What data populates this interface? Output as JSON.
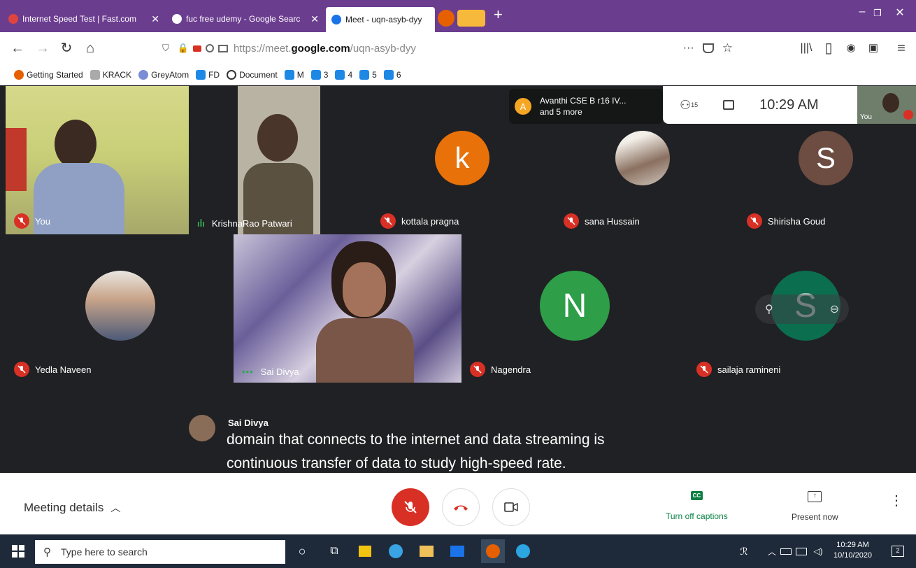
{
  "browser": {
    "tabs": [
      {
        "title": "Internet Speed Test | Fast.com",
        "color": "#e0443e"
      },
      {
        "title": "fuc free udemy - Google Searc",
        "color": "#ffffff"
      },
      {
        "title": "Meet - uqn-asyb-dyy",
        "color": "#1a73e8"
      }
    ],
    "new_tab": "+",
    "window_controls": [
      "–",
      "❐",
      "✕"
    ],
    "url_prefix": "https://meet.",
    "url_domain": "google.com",
    "url_path": "/uqn-asyb-dyy",
    "url_menu": "···",
    "bookmarks": [
      {
        "label": "Getting Started",
        "color": "#e66000"
      },
      {
        "label": "KRACK",
        "color": "#888888"
      },
      {
        "label": "GreyAtom",
        "color": "#7b8cd6"
      },
      {
        "label": "FD",
        "color": "#1e88e5"
      },
      {
        "label": "Document",
        "color": "#333333"
      },
      {
        "label": "M",
        "color": "#1e88e5"
      },
      {
        "label": "3",
        "color": "#1e88e5"
      },
      {
        "label": "4",
        "color": "#1e88e5"
      },
      {
        "label": "5",
        "color": "#1e88e5"
      },
      {
        "label": "6",
        "color": "#1e88e5"
      }
    ]
  },
  "meet": {
    "presenter_pill": {
      "initial": "A",
      "line1": "Avanthi CSE B r16 IV...",
      "line2": "and 5 more"
    },
    "participants_count": "15",
    "clock": "10:29 AM",
    "self_label": "You",
    "tiles": [
      {
        "name": "You",
        "muted": true
      },
      {
        "name": "KrishnaRao Patwari",
        "muted": false
      },
      {
        "name": "kottala pragna",
        "muted": true,
        "initial": "k",
        "avatar_color": "#e8710a"
      },
      {
        "name": "sana Hussain",
        "muted": true
      },
      {
        "name": "Shirisha Goud",
        "muted": true,
        "initial": "S",
        "avatar_color": "#6d4c41"
      },
      {
        "name": "Yedla Naveen",
        "muted": true
      },
      {
        "name": "Sai Divya",
        "muted": false
      },
      {
        "name": "Nagendra",
        "muted": true,
        "initial": "N",
        "avatar_color": "#2e9e48"
      },
      {
        "name": "sailaja ramineni",
        "muted": true,
        "initial": "S",
        "avatar_color": "#0b6e4f"
      }
    ],
    "caption": {
      "speaker": "Sai Divya",
      "line1": "domain that connects to the internet and data streaming is",
      "line2": "continuous transfer of data to study high-speed rate."
    }
  },
  "bottom_bar": {
    "meeting_details": "Meeting details",
    "captions_label": "Turn off captions",
    "captions_icon": "CC",
    "present_label": "Present now"
  },
  "taskbar": {
    "search_placeholder": "Type here to search",
    "time": "10:29 AM",
    "date": "10/10/2020",
    "notification_count": "2"
  }
}
